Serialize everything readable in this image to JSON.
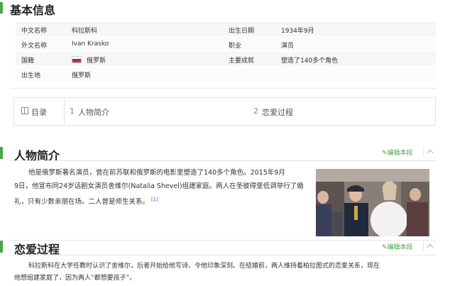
{
  "basic_info": {
    "title": "基本信息",
    "rows": [
      {
        "label_left": "中文名称",
        "value_left": "科拉斯科",
        "label_right": "出生日期",
        "value_right": "1934年9月"
      },
      {
        "label_left": "外文名称",
        "value_left": "Ivan Krasko",
        "label_right": "职业",
        "value_right": "演员"
      },
      {
        "label_left": "国籍",
        "value_left": "俄罗斯",
        "label_right": "主要成就",
        "value_right": "塑造了140多个角色"
      },
      {
        "label_left": "出生地",
        "value_left": "俄罗斯",
        "label_right": "",
        "value_right": ""
      }
    ]
  },
  "toc": {
    "title": "目录",
    "items": [
      {
        "num": "1",
        "label": "人物简介"
      },
      {
        "num": "2",
        "label": "恋爱过程"
      }
    ]
  },
  "section_intro": {
    "title": "人物简介",
    "edit_label": "编辑本段",
    "line1": "他是俄罗斯著名演员，曾在前苏联和俄罗斯的电影里塑造了140多个角色。2015年9月",
    "line2": "9日，他宣布同24岁话剧女演员舍维尔(Natalia Shevel)组建家庭。两人在圣彼得堡低调举行了婚",
    "line3": "礼，只有少数亲朋在场。二人曾是师生关系。",
    "ref": "[1]"
  },
  "section_love": {
    "title": "恋爱过程",
    "edit_label": "编辑本段",
    "line1": "科拉斯科在大学任教时认识了舍维尔，后者开始给他写诗，令他印象深刻。在结婚前，两人维持着柏拉图式的恋爱关系，现在",
    "line2": "他想组建家庭了，因为两人“都想要孩子”。"
  },
  "colors": {
    "accent_green": "#4aa54a",
    "link_blue": "#3366cc"
  }
}
